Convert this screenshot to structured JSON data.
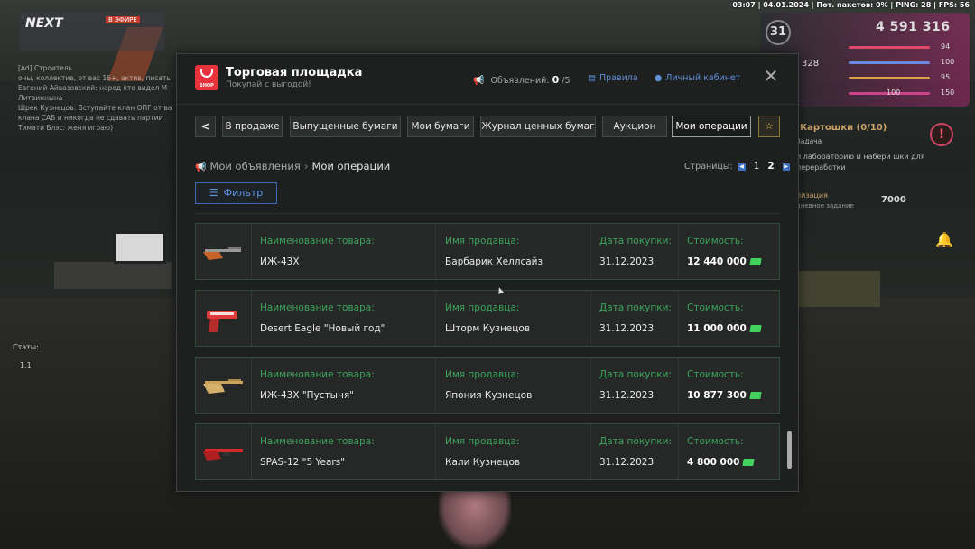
{
  "hud": {
    "top_status": "03:07 | 04.01.2024 | Пот. пакетов: 0% | PING: 28 | FPS: 56",
    "level": "31",
    "money": "4 591 316",
    "health": "94",
    "armor": "100",
    "hunger": "95",
    "stamina": "150",
    "secondary_left": "328",
    "secondary_val": "100"
  },
  "server": {
    "name": "NEXT",
    "tag": "В ЭФИРЕ"
  },
  "chat": {
    "lines": [
      "[Ad] Строитель",
      "оны, коллектив, от вас 16+, актив, писать",
      "Евгений Айвазовский: народ кто видел М",
      "Литвиннына",
      "Шрек Кузнецов: Вступайте клан ОПГ от ва",
      "клана САБ и никогда не сдавать партии",
      "Тимати Блэс: женя играю)"
    ]
  },
  "left_hud": {
    "stats_label": "Статы:",
    "stats_value": "1.1"
  },
  "quest": {
    "title": "Картошки (0/10)",
    "sub": "Задача",
    "desc": "и лабораторию и набери шки для переработки",
    "reward_label": "лизация",
    "reward_sub": "дневное задание",
    "reward": "7000"
  },
  "panel": {
    "title": "Торговая площадка",
    "subtitle": "Покупай с выгодой!",
    "shop_logo_text": "SHOP",
    "ads_label": "Объявлений:",
    "ads_count": "0",
    "ads_total": "/5",
    "rules_link": "Правила",
    "cabinet_link": "Личный кабинет",
    "close": "✕"
  },
  "tabs": [
    {
      "label": "<"
    },
    {
      "label": "В продаже"
    },
    {
      "label": "Выпущенные бумаги"
    },
    {
      "label": "Мои бумаги"
    },
    {
      "label": "Журнал ценных бумаг"
    },
    {
      "label": "Аукцион"
    },
    {
      "label": "Мои операции"
    },
    {
      "label": "☆"
    }
  ],
  "breadcrumb": {
    "root": "Мои объявления",
    "current": "Мои операции"
  },
  "pagination": {
    "label": "Страницы:",
    "pages": [
      "1",
      "2"
    ],
    "current": "2"
  },
  "filter_label": "Фильтр",
  "columns": {
    "item": "Наименование товара:",
    "seller": "Имя продавца:",
    "date": "Дата покупки:",
    "price": "Стоимость:"
  },
  "operations": [
    {
      "item": "ИЖ-43Х",
      "seller": "Барбарик Хеллсайз",
      "date": "31.12.2023",
      "price": "12 440 000",
      "icon": "shotgun-orange-icon"
    },
    {
      "item": "Desert Eagle \"Новый год\"",
      "seller": "Шторм Кузнецов",
      "date": "31.12.2023",
      "price": "11 000 000",
      "icon": "pistol-red-icon"
    },
    {
      "item": "ИЖ-43Х \"Пустыня\"",
      "seller": "Япония Кузнецов",
      "date": "31.12.2023",
      "price": "10 877 300",
      "icon": "shotgun-desert-icon"
    },
    {
      "item": "SPAS-12 \"5 Years\"",
      "seller": "Кали Кузнецов",
      "date": "31.12.2023",
      "price": "4 800 000",
      "icon": "shotgun-red-icon"
    }
  ],
  "colors": {
    "accent_blue": "#5f8fd8",
    "label_green": "#3da35b",
    "shop_red": "#e8333d",
    "cash_green": "#40d25c"
  }
}
